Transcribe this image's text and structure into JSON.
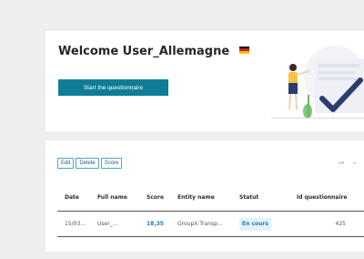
{
  "welcome": {
    "title": "Welcome User_Allemagne",
    "start_button": "Start the questionnaire",
    "flag_icon": "germany-flag-icon"
  },
  "toolbar": {
    "edit": "Edit",
    "delete": "Delete",
    "score": "Score"
  },
  "pager": {
    "first": "⏮",
    "prev": "«"
  },
  "table": {
    "headers": {
      "date": "Date",
      "full_name": "Full name",
      "score": "Score",
      "entity": "Entity name",
      "statut": "Statut",
      "id": "Id questionnaire"
    },
    "rows": [
      {
        "date": "15/03...",
        "full_name": "User_...",
        "score": "18,35",
        "entity": "GroupX Transp...",
        "statut": "En cours",
        "id": "425"
      }
    ]
  },
  "colors": {
    "accent": "#0f7d96",
    "badge_bg": "#e3f2fa",
    "background": "#eeedf0"
  }
}
